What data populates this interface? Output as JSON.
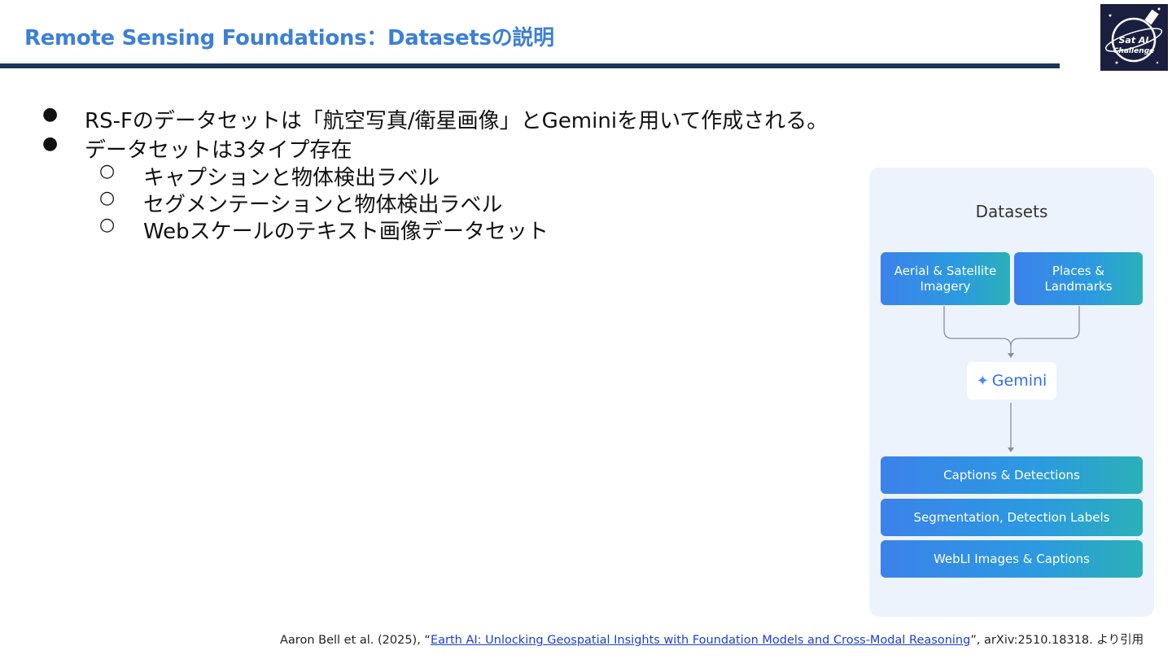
{
  "slide": {
    "title": "Remote Sensing Foundations：Datasetsの説明",
    "logo_text": "Sat AI Challenge"
  },
  "bullets": [
    {
      "marker": "●",
      "text": "RS-Fのデータセットは「航空写真/衛星画像」とGeminiを用いて作成される。"
    },
    {
      "marker": "●",
      "text": "データセットは3タイプ存在"
    }
  ],
  "sub_bullets": [
    {
      "marker": "○",
      "text": "キャプションと物体検出ラベル"
    },
    {
      "marker": "○",
      "text": "セグメンテーションと物体検出ラベル"
    },
    {
      "marker": "○",
      "text": "Webスケールのテキスト画像データセット"
    }
  ],
  "figure": {
    "title": "Datasets",
    "inputs": [
      "Aerial & Satellite Imagery",
      "Places & Landmarks"
    ],
    "processor": "Gemini",
    "outputs": [
      "Captions & Detections",
      "Segmentation, Detection Labels",
      "WebLI Images & Captions"
    ],
    "colors": {
      "panel": "#edf3fc",
      "box_start": "#3b82ea",
      "box_end": "#2bb0b8",
      "title_accent": "#3d7fd6",
      "rule": "#17385a"
    }
  },
  "citation": {
    "prefix": "Aaron Bell et al. (2025), “",
    "link_text": "Earth AI: Unlocking Geospatial Insights with Foundation Models and Cross-Modal Reasoning",
    "suffix": "”, arXiv:2510.18318. より引用"
  }
}
